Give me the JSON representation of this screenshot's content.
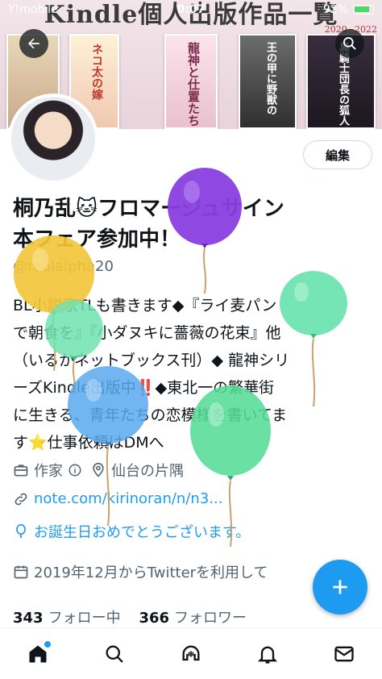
{
  "status_bar": {
    "carrier": "Y!mobile",
    "time": "0:07",
    "battery": "92%"
  },
  "banner": {
    "title": "Kindle個人出版作品一覧",
    "subtitle": "2020~2022",
    "books": [
      {
        "text": ""
      },
      {
        "text": "ネコ太の嫁"
      },
      {
        "text": "龍神と仕置たち"
      },
      {
        "text": "王の甲に野獣の"
      },
      {
        "text": "黒騎士団長の狐人"
      }
    ]
  },
  "profile": {
    "name_line1": "桐乃乱🐱フロマージュサイン",
    "name_line2": "本フェア参加中！",
    "handle": "@realalpha20",
    "edit_label": "編集",
    "bio": [
      "BL小説家TLも書きます◆『ライ麦パン",
      "で朝食を』『小ダヌキに薔薇の花束』他",
      "（いるかネットブックス刊）◆ 龍神シリ",
      "ーズKindle出版中‼️◆東北一の繁華街",
      "に生きる、青年たちの恋模様を書いてま",
      "す⭐仕事依頼はDMへ"
    ],
    "category": "作家",
    "location": "仙台の片隅",
    "link": "note.com/kirinoran/n/n3...",
    "birthday_message": "お誕生日おめでとうございます。",
    "joined": "2019年12月からTwitterを利用して",
    "following_count": "343",
    "following_label": "フォロー中",
    "followers_count": "366",
    "followers_label": "フォロワー"
  },
  "icons": {
    "back": "back-arrow-icon",
    "search": "search-icon",
    "info": "info-icon",
    "location": "location-pin-icon",
    "link": "link-icon",
    "balloon": "balloon-icon",
    "calendar": "calendar-icon",
    "compose": "plus-icon",
    "home": "home-icon",
    "spaces": "spaces-icon",
    "notifications": "bell-icon",
    "messages": "mail-icon"
  },
  "colors": {
    "accent": "#1d9bf0",
    "text": "#0f1419",
    "muted": "#536471"
  }
}
